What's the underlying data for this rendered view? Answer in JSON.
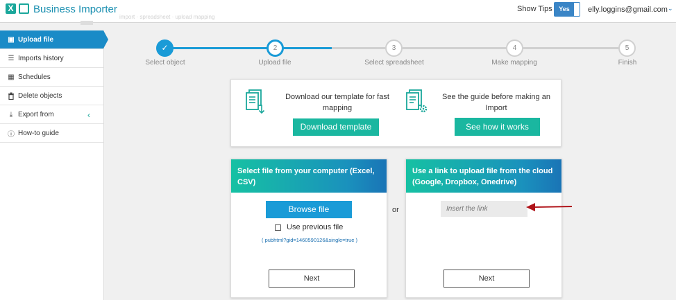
{
  "app": {
    "title": "Business Importer",
    "logo_letter": "X",
    "ghost_breadcrumb": "import  ·  spreadsheet  ·  upload mapping"
  },
  "header": {
    "tips_label": "Show Tips",
    "tips_toggle": "Yes",
    "user_email": "elly.loggins@gmail.com",
    "user_caret": "⌄"
  },
  "sidebar": {
    "items": [
      {
        "label": "Upload file",
        "icon": "file-upload-icon",
        "glyph": "▣"
      },
      {
        "label": "Imports history",
        "icon": "list-icon",
        "glyph": "☰"
      },
      {
        "label": "Schedules",
        "icon": "calendar-icon",
        "glyph": "▦"
      },
      {
        "label": "Delete objects",
        "icon": "trash-icon",
        "glyph": "🗑"
      },
      {
        "label": "Export from",
        "icon": "download-icon",
        "glyph": "⤓",
        "caret": "‹"
      },
      {
        "label": "How-to guide",
        "icon": "info-icon",
        "glyph": "ⓘ"
      }
    ]
  },
  "stepper": {
    "steps": [
      {
        "num": "✓",
        "label": "Select object"
      },
      {
        "num": "2",
        "label": "Upload file"
      },
      {
        "num": "3",
        "label": "Select spreadsheet"
      },
      {
        "num": "4",
        "label": "Make mapping"
      },
      {
        "num": "5",
        "label": "Finish"
      }
    ]
  },
  "template_card": {
    "left_text": "Download our template for fast mapping",
    "left_button": "Download template",
    "right_text": "See the guide before making an Import",
    "right_button": "See how it works"
  },
  "upload_computer": {
    "title": "Select file from your computer (Excel, CSV)",
    "browse_button": "Browse file",
    "use_previous": "Use previous file",
    "previous_link": "( pubhtml?gid=1460590126&single=true )",
    "next_button": "Next"
  },
  "or_label": "or",
  "upload_cloud": {
    "title": "Use a link to upload file from the cloud (Google, Dropbox, Onedrive)",
    "link_placeholder": "Insert the link",
    "next_button": "Next"
  },
  "colors": {
    "brand": "#1aa79b",
    "active_blue": "#1a8bc7",
    "teal_button": "#1ab7a0",
    "browse_blue": "#1a9bd7",
    "arrow_red": "#b0141a"
  }
}
